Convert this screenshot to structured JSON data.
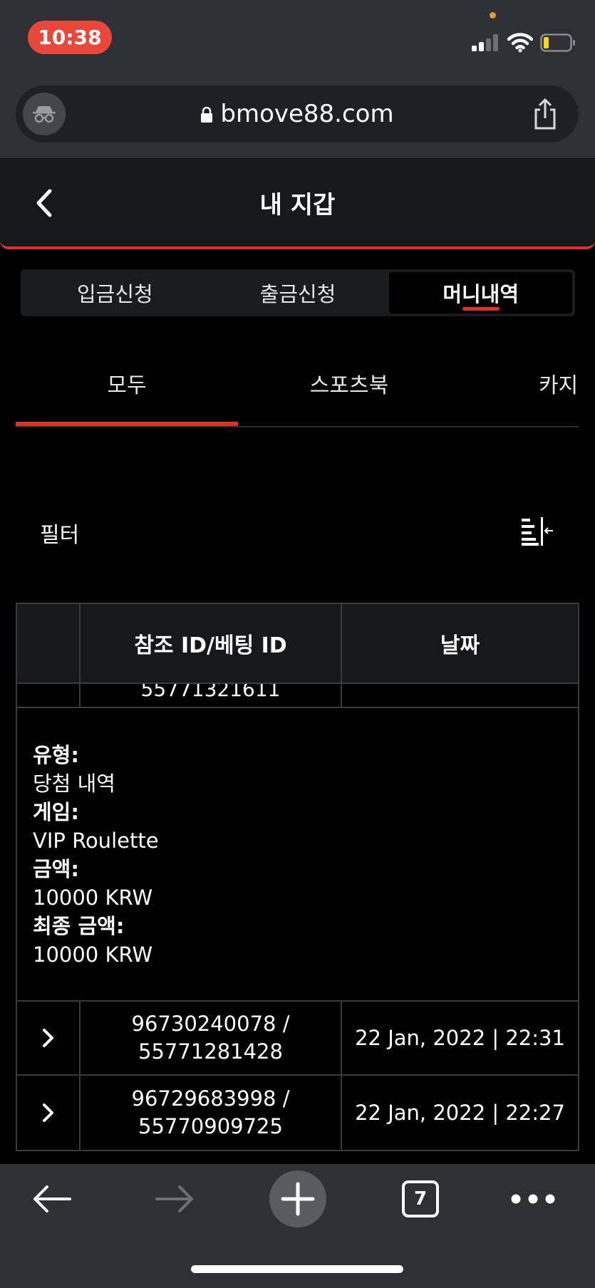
{
  "status_bar": {
    "time": "10:38"
  },
  "browser": {
    "url": "bmove88.com",
    "tab_count": "7"
  },
  "header": {
    "title": "내 지갑"
  },
  "wallet_tabs": [
    {
      "label": "입금신청"
    },
    {
      "label": "출금신청"
    },
    {
      "label": "머니내역"
    }
  ],
  "category_tabs": [
    {
      "label": "모두"
    },
    {
      "label": "스포츠북"
    },
    {
      "label": "카지"
    }
  ],
  "filter": {
    "label": "필터"
  },
  "table": {
    "headers": [
      "",
      "참조 ID/베팅 ID",
      "날짜"
    ],
    "partial_row": {
      "ref_id": "55771321611"
    },
    "details": {
      "type_label": "유형:",
      "type_value": "당첨 내역",
      "game_label": "게임:",
      "game_value": "VIP Roulette",
      "amount_label": "금액:",
      "amount_value": "10000 KRW",
      "final_label": "최종 금액:",
      "final_value": "10000 KRW"
    },
    "rows": [
      {
        "ref_line1": "96730240078 /",
        "ref_line2": "55771281428",
        "date": "22 Jan, 2022 | 22:31"
      },
      {
        "ref_line1": "96729683998 /",
        "ref_line2": "55770909725",
        "date": "22 Jan, 2022 | 22:27"
      }
    ]
  },
  "colors": {
    "accent": "#e0302a",
    "chrome": "#2f3033",
    "time_pill": "#e8473a"
  }
}
